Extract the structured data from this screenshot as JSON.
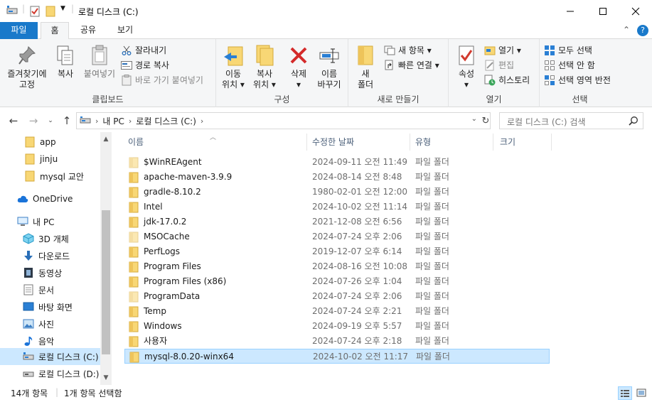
{
  "window": {
    "title": "로컬 디스크 (C:)",
    "controls": [
      "minimize",
      "maximize",
      "close"
    ]
  },
  "ribbon_tabs": [
    "파일",
    "홈",
    "공유",
    "보기"
  ],
  "ribbon": {
    "clipboard": {
      "label": "클립보드",
      "pin": "즐겨찾기에\n고정",
      "copy": "복사",
      "paste": "붙여넣기",
      "cut": "잘라내기",
      "copy_path": "경로 복사",
      "paste_shortcut": "바로 가기 붙여넣기"
    },
    "organize": {
      "label": "구성",
      "move_to": "이동\n위치 ▾",
      "copy_to": "복사\n위치 ▾",
      "delete": "삭제\n▾",
      "rename": "이름\n바꾸기"
    },
    "new": {
      "label": "새로 만들기",
      "new_folder": "새\n폴더",
      "new_item": "새 항목 ▾",
      "easy_access": "빠른 연결 ▾"
    },
    "open": {
      "label": "열기",
      "properties": "속성\n▾",
      "open": "열기 ▾",
      "edit": "편집",
      "history": "히스토리"
    },
    "select": {
      "label": "선택",
      "select_all": "모두 선택",
      "select_none": "선택 안 함",
      "invert": "선택 영역 반전"
    }
  },
  "address": {
    "crumbs": [
      "내 PC",
      "로컬 디스크 (C:)"
    ],
    "search_placeholder": "로컬 디스크 (C:) 검색"
  },
  "nav_pane": {
    "items": [
      {
        "label": "app",
        "icon": "folder-icon"
      },
      {
        "label": "jinju",
        "icon": "folder-icon"
      },
      {
        "label": "mysql 교안",
        "icon": "folder-icon"
      },
      {
        "label": "OneDrive",
        "icon": "cloud-icon"
      },
      {
        "label": "내 PC",
        "icon": "pc-icon"
      },
      {
        "label": "3D 개체",
        "icon": "cube-icon"
      },
      {
        "label": "다운로드",
        "icon": "download-icon"
      },
      {
        "label": "동영상",
        "icon": "video-icon"
      },
      {
        "label": "문서",
        "icon": "document-icon"
      },
      {
        "label": "바탕 화면",
        "icon": "desktop-icon"
      },
      {
        "label": "사진",
        "icon": "pictures-icon"
      },
      {
        "label": "음악",
        "icon": "music-icon"
      },
      {
        "label": "로컬 디스크 (C:)",
        "icon": "drive-icon"
      },
      {
        "label": "로컬 디스크 (D:)",
        "icon": "drive-icon"
      }
    ]
  },
  "columns": [
    "이름",
    "수정한 날짜",
    "유형",
    "크기"
  ],
  "files": [
    {
      "name": "$WinREAgent",
      "date": "2024-09-11 오전 11:49",
      "type": "파일 폴더",
      "faded": true
    },
    {
      "name": "apache-maven-3.9.9",
      "date": "2024-08-14 오전 8:48",
      "type": "파일 폴더"
    },
    {
      "name": "gradle-8.10.2",
      "date": "1980-02-01 오전 12:00",
      "type": "파일 폴더"
    },
    {
      "name": "Intel",
      "date": "2024-10-02 오전 11:14",
      "type": "파일 폴더"
    },
    {
      "name": "jdk-17.0.2",
      "date": "2021-12-08 오전 6:56",
      "type": "파일 폴더"
    },
    {
      "name": "MSOCache",
      "date": "2024-07-24 오후 2:06",
      "type": "파일 폴더",
      "faded": true
    },
    {
      "name": "PerfLogs",
      "date": "2019-12-07 오후 6:14",
      "type": "파일 폴더"
    },
    {
      "name": "Program Files",
      "date": "2024-08-16 오전 10:08",
      "type": "파일 폴더"
    },
    {
      "name": "Program Files (x86)",
      "date": "2024-07-26 오후 1:04",
      "type": "파일 폴더"
    },
    {
      "name": "ProgramData",
      "date": "2024-07-24 오후 2:06",
      "type": "파일 폴더",
      "faded": true
    },
    {
      "name": "Temp",
      "date": "2024-07-24 오후 2:21",
      "type": "파일 폴더"
    },
    {
      "name": "Windows",
      "date": "2024-09-19 오후 5:57",
      "type": "파일 폴더"
    },
    {
      "name": "사용자",
      "date": "2024-07-24 오후 2:18",
      "type": "파일 폴더"
    },
    {
      "name": "mysql-8.0.20-winx64",
      "date": "2024-10-02 오전 11:17",
      "type": "파일 폴더",
      "selected": true
    }
  ],
  "status": {
    "count": "14개 항목",
    "selection": "1개 항목 선택함"
  },
  "colors": {
    "accent": "#1979ca",
    "selection": "#cce8ff",
    "selection_border": "#99d1ff",
    "folder": "#f8d775",
    "ribbon_bg": "#f5f6f7"
  }
}
